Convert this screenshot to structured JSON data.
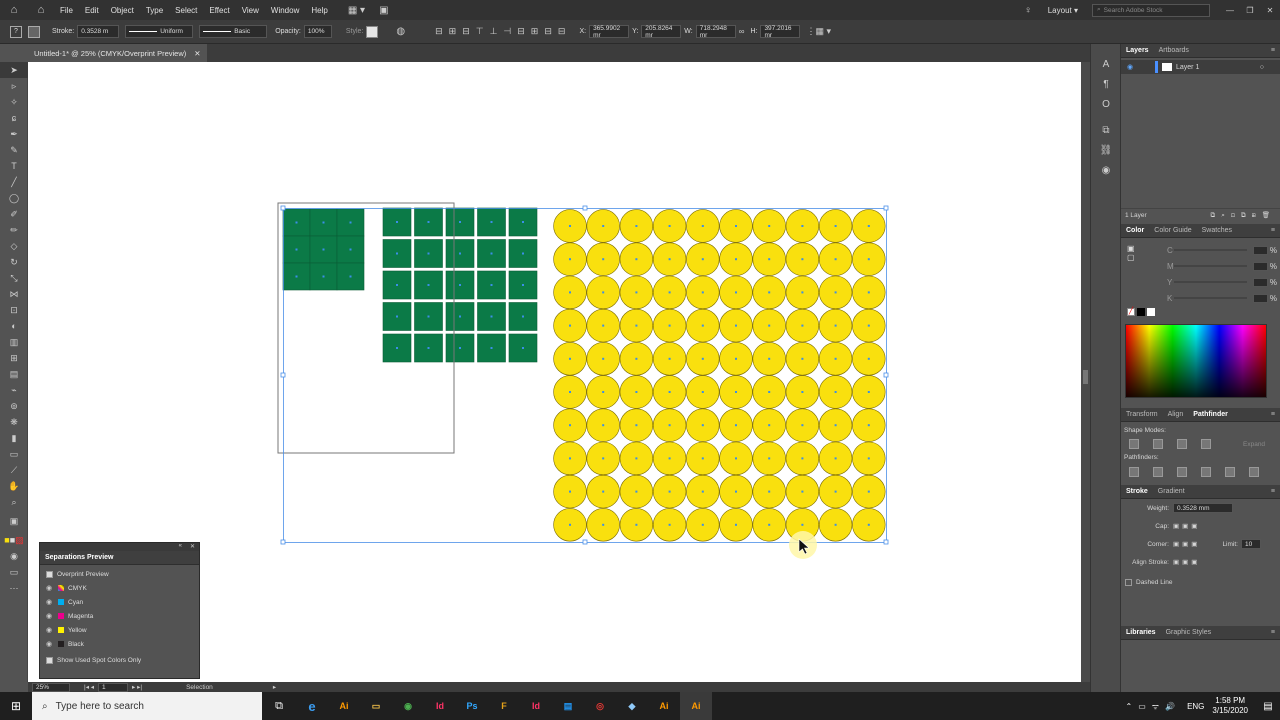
{
  "menu": [
    "File",
    "Edit",
    "Object",
    "Type",
    "Select",
    "Effect",
    "View",
    "Window",
    "Help"
  ],
  "workspace": "Layout",
  "search_placeholder": "Search Adobe Stock",
  "control": {
    "stroke_label": "Stroke:",
    "stroke_value": "0.3528 m",
    "profile": "Uniform",
    "brush": "Basic",
    "opacity_label": "Opacity:",
    "opacity_value": "100%",
    "style_label": "Style:",
    "x_label": "X:",
    "x_value": "365.9902 mr",
    "y_label": "Y:",
    "y_value": "205.8264 mr",
    "w_label": "W:",
    "w_value": "718.2948 mr",
    "h_label": "H:",
    "h_value": "397.2016 mr"
  },
  "doc_tab": "Untitled-1* @ 25% (CMYK/Overprint Preview)",
  "status": {
    "zoom": "25%",
    "page": "1",
    "tool": "Selection"
  },
  "layers": {
    "tabs": [
      "Layers",
      "Artboards"
    ],
    "layer_name": "Layer 1",
    "count": "1 Layer"
  },
  "color_panel": {
    "tabs": [
      "Color",
      "Color Guide",
      "Swatches"
    ],
    "channels": [
      "C",
      "M",
      "Y",
      "K"
    ],
    "unit": "%"
  },
  "pathfinder": {
    "tabs": [
      "Transform",
      "Align",
      "Pathfinder"
    ],
    "shape_modes": "Shape Modes:",
    "expand": "Expand",
    "pathfinders": "Pathfinders:"
  },
  "stroke_panel": {
    "tabs": [
      "Stroke",
      "Gradient"
    ],
    "weight_label": "Weight:",
    "weight_value": "0.3528 mm",
    "cap_label": "Cap:",
    "corner_label": "Corner:",
    "limit_label": "Limit:",
    "limit_value": "10",
    "align_label": "Align Stroke:",
    "dashed": "Dashed Line"
  },
  "libraries": [
    "Libraries",
    "Graphic Styles"
  ],
  "separations": {
    "title": "Separations Preview",
    "overprint": "Overprint Preview",
    "plates": [
      {
        "name": "CMYK",
        "color": "#ffffff"
      },
      {
        "name": "Cyan",
        "color": "#00aeef"
      },
      {
        "name": "Magenta",
        "color": "#ec008c"
      },
      {
        "name": "Yellow",
        "color": "#fff200"
      },
      {
        "name": "Black",
        "color": "#231f20"
      }
    ],
    "spot_only": "Show Used Spot Colors Only"
  },
  "artwork": {
    "green_fill": "#0b7a47",
    "yellow_fill": "#f9e00e",
    "small_grid": {
      "cols": 3,
      "rows": 3
    },
    "mid_grid": {
      "cols": 5,
      "rows": 5
    },
    "circle_grid": {
      "cols": 10,
      "rows": 10
    }
  },
  "taskbar": {
    "search": "Type here to search",
    "apps": [
      {
        "label": "Ai",
        "color": "#ff9a00"
      },
      {
        "label": "▭",
        "color": "#f3c04a"
      },
      {
        "label": "◉",
        "color": "#4caf50"
      },
      {
        "label": "Id",
        "color": "#ff3366"
      },
      {
        "label": "Ps",
        "color": "#31a8ff"
      },
      {
        "label": "F",
        "color": "#e5a21a"
      },
      {
        "label": "Id",
        "color": "#ff3366"
      },
      {
        "label": "▤",
        "color": "#2196f3"
      },
      {
        "label": "◎",
        "color": "#e53935"
      },
      {
        "label": "◆",
        "color": "#90caf9"
      },
      {
        "label": "Ai",
        "color": "#ff9a00"
      },
      {
        "label": "Ai",
        "color": "#ff9a00"
      }
    ],
    "lang": "ENG",
    "time": "1:58 PM",
    "date": "3/15/2020"
  }
}
